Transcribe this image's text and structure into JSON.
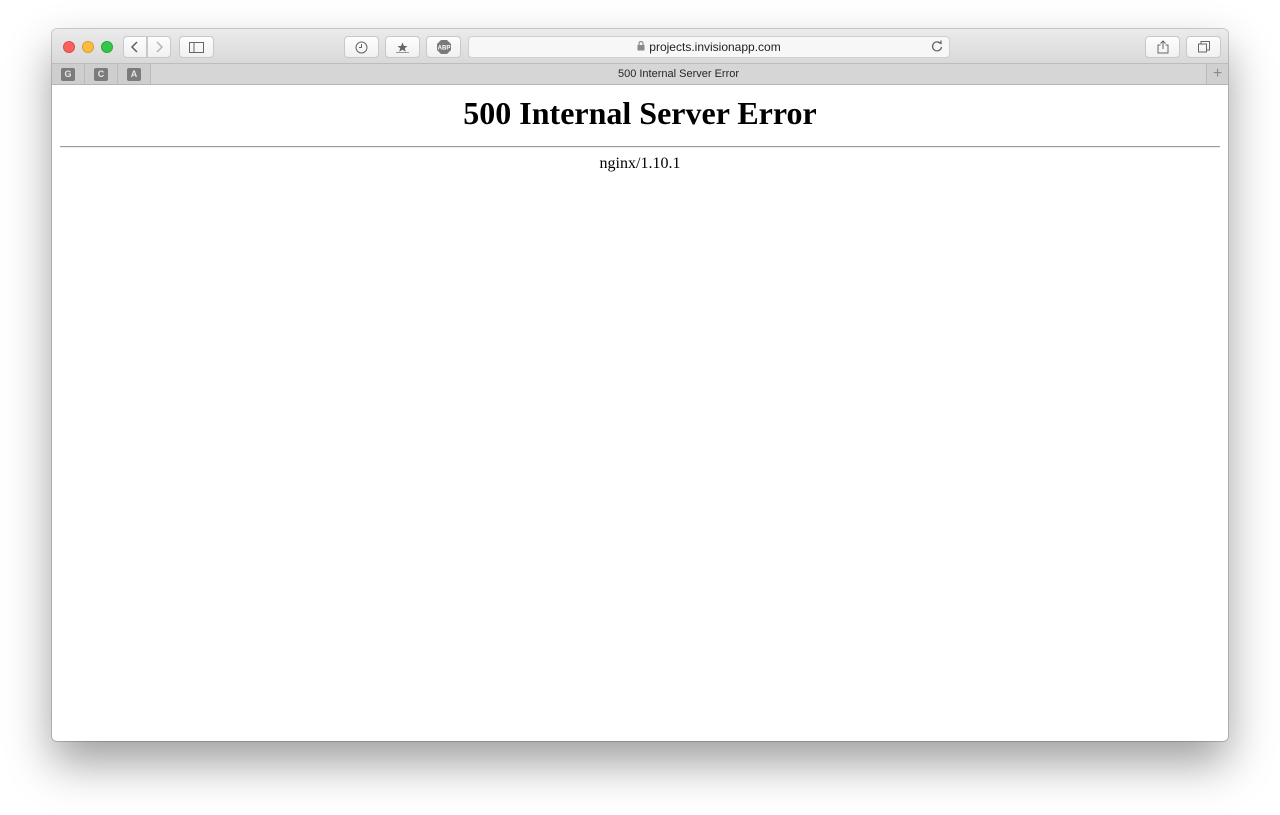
{
  "browser": {
    "address": "projects.invisionapp.com",
    "icons": {
      "back": "chevron-left-icon",
      "forward": "chevron-right-icon",
      "sidebar": "sidebar-icon",
      "history": "clock-icon",
      "bookmarks": "star-icon",
      "adblock": "abp-icon",
      "lock": "lock-icon",
      "reload": "reload-icon",
      "share": "share-icon",
      "tabs": "tabs-overview-icon"
    },
    "adblock_label": "ABP",
    "pinned_tabs": [
      "G",
      "C",
      "A"
    ],
    "tab_title": "500 Internal Server Error",
    "new_tab_label": "+"
  },
  "page": {
    "heading": "500 Internal Server Error",
    "server_signature": "nginx/1.10.1"
  }
}
